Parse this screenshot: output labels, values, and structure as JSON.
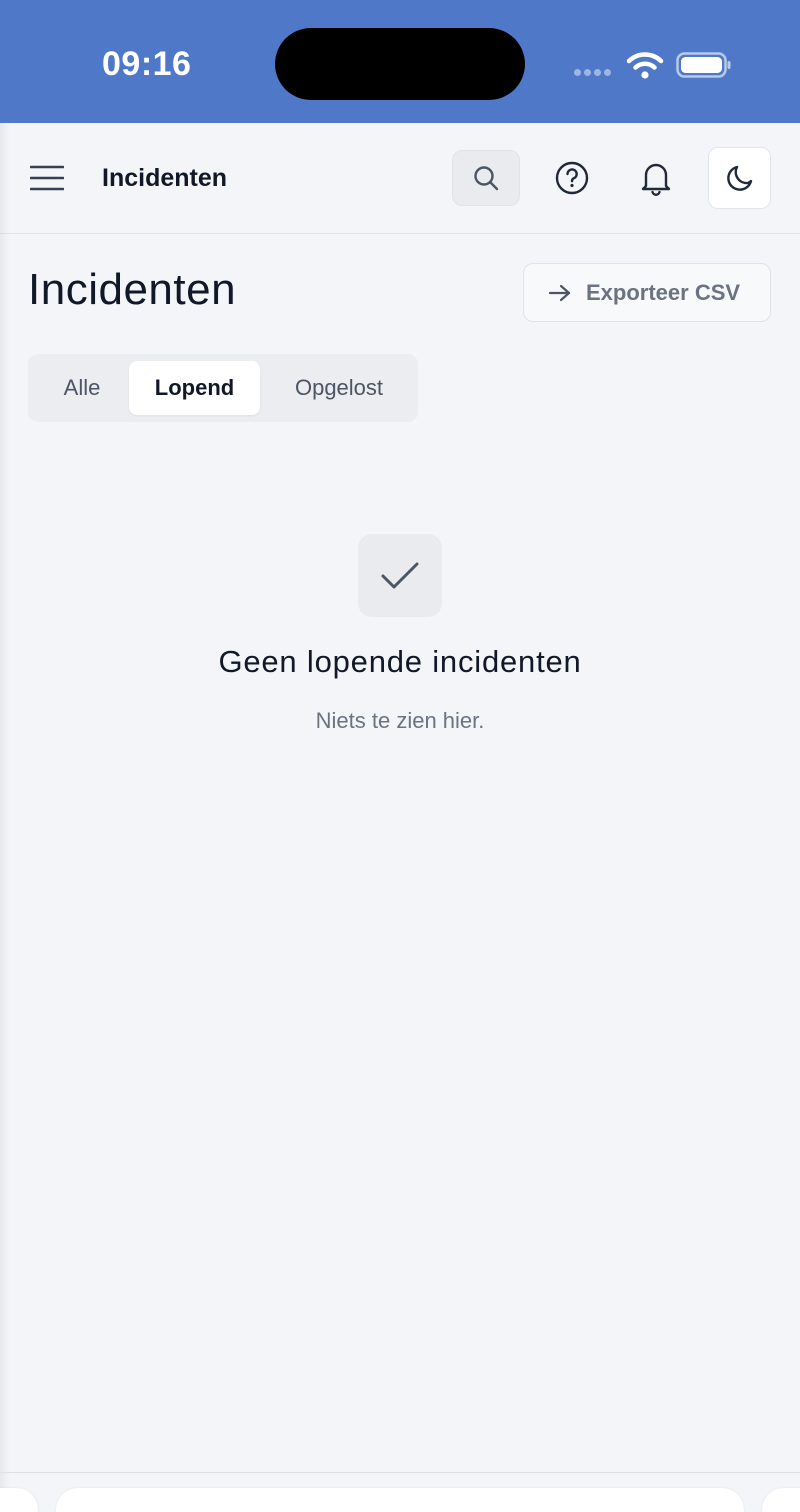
{
  "status_bar": {
    "time": "09:16",
    "bg_color": "#5078c8"
  },
  "app_bar": {
    "title": "Incidenten",
    "icons": [
      "menu-icon",
      "search-icon",
      "help-icon",
      "bell-icon",
      "moon-icon"
    ]
  },
  "page": {
    "title": "Incidenten",
    "export_label": "Exporteer CSV",
    "export_icon": "arrow-right-icon"
  },
  "tabs": {
    "items": [
      "Alle",
      "Lopend",
      "Opgelost"
    ],
    "selected": "Lopend"
  },
  "empty_state": {
    "icon": "check-icon",
    "title": "Geen lopende incidenten",
    "subtitle": "Niets te zien hier."
  },
  "colors": {
    "background": "#f4f5f8",
    "text_primary": "#111827",
    "text_secondary": "#6b7280"
  }
}
